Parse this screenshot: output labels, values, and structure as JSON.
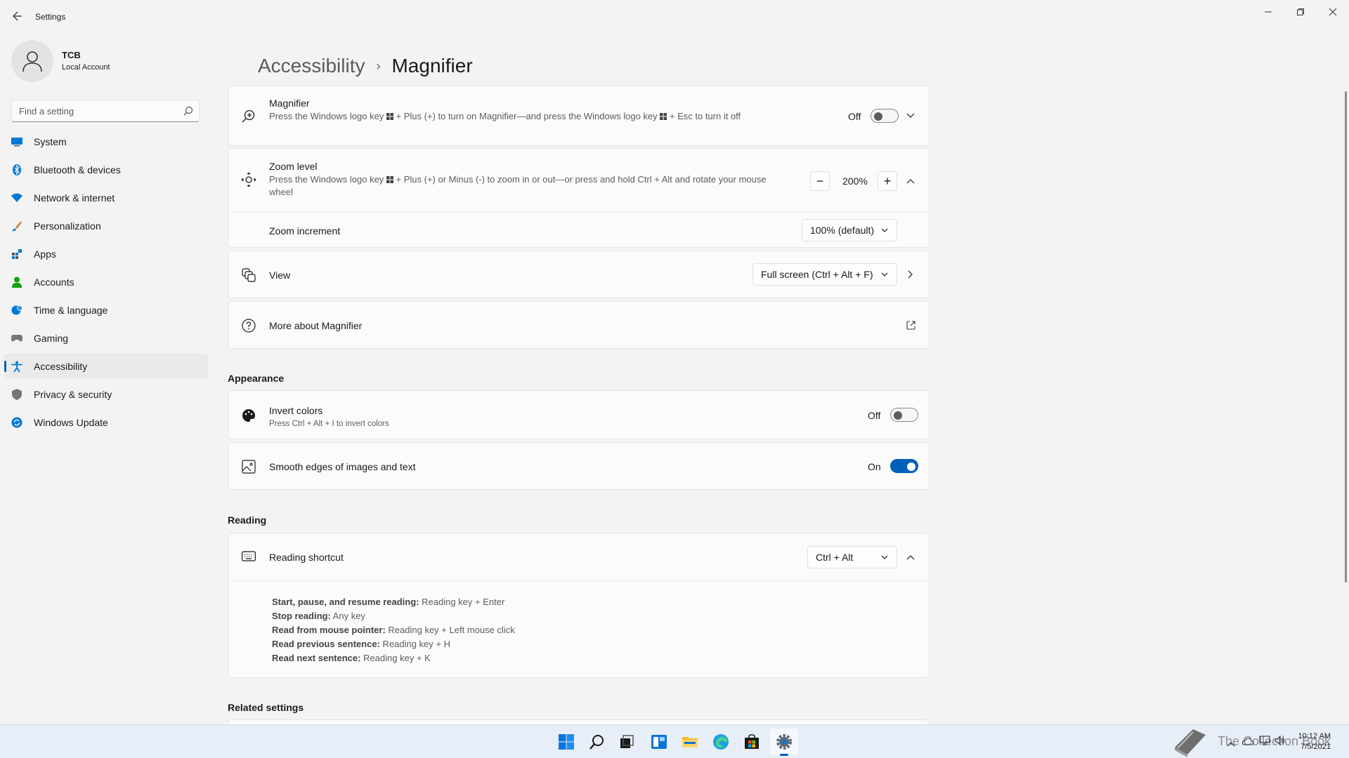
{
  "window": {
    "title": "Settings"
  },
  "profile": {
    "name": "TCB",
    "account_type": "Local Account"
  },
  "search": {
    "placeholder": "Find a setting"
  },
  "sidebar": {
    "items": [
      {
        "label": "System",
        "icon": "system-icon",
        "active": false
      },
      {
        "label": "Bluetooth & devices",
        "icon": "bluetooth-icon",
        "active": false
      },
      {
        "label": "Network & internet",
        "icon": "wifi-icon",
        "active": false
      },
      {
        "label": "Personalization",
        "icon": "brush-icon",
        "active": false
      },
      {
        "label": "Apps",
        "icon": "apps-icon",
        "active": false
      },
      {
        "label": "Accounts",
        "icon": "person-icon",
        "active": false
      },
      {
        "label": "Time & language",
        "icon": "globe-clock-icon",
        "active": false
      },
      {
        "label": "Gaming",
        "icon": "gamepad-icon",
        "active": false
      },
      {
        "label": "Accessibility",
        "icon": "accessibility-icon",
        "active": true
      },
      {
        "label": "Privacy & security",
        "icon": "shield-icon",
        "active": false
      },
      {
        "label": "Windows Update",
        "icon": "update-icon",
        "active": false
      }
    ]
  },
  "breadcrumb": {
    "parent": "Accessibility",
    "separator": "›",
    "current": "Magnifier"
  },
  "magnifier": {
    "title": "Magnifier",
    "description_part1": "Press the Windows logo key ",
    "description_part2": " + Plus (+) to turn on Magnifier—and press the Windows logo key ",
    "description_part3": " + Esc to turn it off",
    "state_label": "Off",
    "on": false
  },
  "zoom_level": {
    "title": "Zoom level",
    "description_part1": "Press the Windows logo key ",
    "description_part2": " + Plus (+) or Minus (-) to zoom in or out—or press and hold Ctrl + Alt and rotate your mouse wheel",
    "value": "200%",
    "minus": "−",
    "plus": "+"
  },
  "zoom_increment": {
    "title": "Zoom increment",
    "value": "100% (default)"
  },
  "view": {
    "title": "View",
    "value": "Full screen (Ctrl + Alt + F)"
  },
  "more_about": {
    "title": "More about Magnifier"
  },
  "appearance": {
    "section_title": "Appearance",
    "invert_colors": {
      "title": "Invert colors",
      "description": "Press Ctrl + Alt + I to invert colors",
      "state_label": "Off",
      "on": false
    },
    "smooth_edges": {
      "title": "Smooth edges of images and text",
      "state_label": "On",
      "on": true
    }
  },
  "reading": {
    "section_title": "Reading",
    "shortcut": {
      "title": "Reading shortcut",
      "value": "Ctrl + Alt"
    },
    "commands": [
      {
        "key": "Start, pause, and resume reading:",
        "value": " Reading key + Enter"
      },
      {
        "key": "Stop reading:",
        "value": " Any key"
      },
      {
        "key": "Read from mouse pointer:",
        "value": " Reading key + Left mouse click"
      },
      {
        "key": "Read previous sentence:",
        "value": " Reading key + H"
      },
      {
        "key": "Read next sentence:",
        "value": " Reading key + K"
      }
    ]
  },
  "related": {
    "section_title": "Related settings"
  },
  "taskbar": {
    "watermark": "The Collection Book",
    "clock_time": "10:12 AM",
    "clock_date": "7/5/2021"
  },
  "colors": {
    "accent": "#005fb8",
    "background": "#f3f3f3",
    "card": "#fbfbfb"
  }
}
